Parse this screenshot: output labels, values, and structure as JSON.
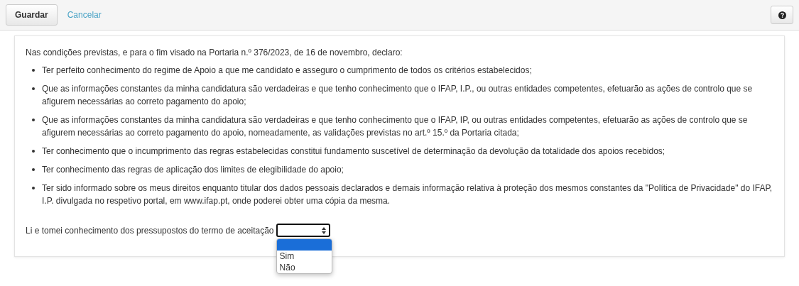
{
  "toolbar": {
    "buttons": [
      {
        "label": "Guardar",
        "kind": "button"
      },
      {
        "label": "Cancelar",
        "kind": "link"
      }
    ]
  },
  "declaration": {
    "intro": "Nas condições previstas, e para o fim visado na Portaria n.º 376/2023, de 16 de novembro, declaro:",
    "items": [
      "Ter perfeito conhecimento do regime de Apoio a que me candidato e asseguro o cumprimento de todos os critérios estabelecidos;",
      "Que as informações constantes da minha candidatura são verdadeiras e que tenho conhecimento que o IFAP, I.P., ou outras entidades competentes, efetuarão as ações de controlo que se afigurem necessárias ao correto pagamento do apoio;",
      "Que as informações constantes da minha candidatura são verdadeiras e que tenho conhecimento que o IFAP, IP, ou outras entidades competentes, efetuarão as ações de controlo que se afigurem necessárias ao correto pagamento do apoio, nomeadamente, as validações previstas no art.º 15.º da Portaria citada;",
      "Ter conhecimento que o incumprimento das regras estabelecidas constitui fundamento suscetível de determinação da devolução da totalidade dos apoios recebidos;",
      "Ter conhecimento das regras de aplicação dos limites de elegibilidade do apoio;",
      "Ter sido informado sobre os meus direitos enquanto titular dos dados pessoais declarados e demais informação relativa à proteção dos mesmos constantes da \"Política de Privacidade\" do IFAP, I.P. divulgada no respetivo portal, em www.ifap.pt, onde poderei obter uma cópia da mesma."
    ]
  },
  "acceptance": {
    "label": "Li e tomei conhecimento dos pressupostos do termo de aceitação",
    "expanded": true,
    "options": [
      {
        "selected": true
      },
      {
        "label": "Sim",
        "selected": false
      },
      {
        "label": "Não",
        "selected": false
      }
    ]
  }
}
